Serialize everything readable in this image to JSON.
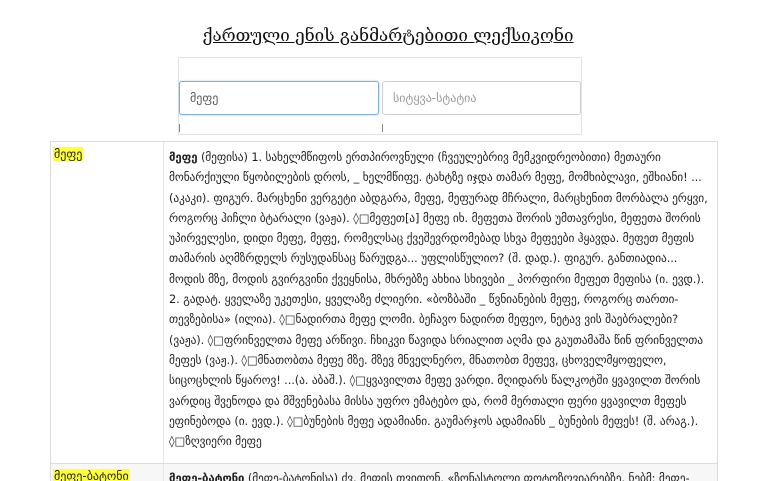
{
  "page_title": "ქართული ენის განმარტებითი ლექსიკონი",
  "search": {
    "word_value": "მეფე",
    "article_placeholder": "სიტყვა-სტატია"
  },
  "entries": [
    {
      "word": "მეფე",
      "headword": "მეფე",
      "definition": " (მეფისა) 1. სახელმწიფოს ერთპიროვნული (ჩვეულებრივ მემკვიდრეობითი) მეთაური მონარქიული წყობილების დროს, _ ხელმწიფე. ტახტზე იჯდა თამარ მეფე, მომხიბლავი, ეშხიანი! ...(აკაკი). ფიგურ. მარცხენი ვერგეტი აბდგარა, მეფე, მეფურად მჩრალი, მარცხენით მორბალა ერყვი, როგორც ჰიჩლი ბტარალი (ვაჟა). ◊□მეფეთ[ა] მეფე იხ. მეფეთა შორის უმთავრესი, მეფეთა შორის უპირველესი, დიდი მეფე, მეფე, რომელსაც ქვეშევრდომებად სხვა მეფეები ჰყავდა. მეფეთ მეფის თამარის აღმზრდელს რუსუდანსაც წარუდგა... უფლისწულიო? (შ. დად.). ფიგურ. განთიადია... მოდის მზე, მოდის გვირგვინი ქვეყნისა, მხრებზე ახხია სხივები _ პორფირი მეფეთ მეფისა (ი. ევდ.). 2. გადატ. ყველაზე უკეთესი, ყველაზე ძლიერი. «ბოზბაში _ წვნიანების მეფე, როგორც თართი-თევზებისა» (ილია). ◊□ნადირთა მეფე ლომი. ბეჩავო ნადირთ მეფეო, ნეტავ ვის შაებრალები? (ვაჟა). ◊□ფრინველთა მეფე არწივი. ჩხიკვი წავიდა სრიალით აღმა და გაუთამაშა წინ ფრინველთა მეფეს (ვაჟ.). ◊□მნათობთა მეფე მზე. მზევ მნველნერო, მნათობთ მეფევ, ცხოველმყოფელო, სიცოცხლის წყაროვ! ...(ა. აბაშ.). ◊□ყვავილთა მეფე ვარდი. მღიდარს წალკოტში ყვავილთ შორის ვარდიც შვენოდა და მშვენებასა მისსა უფრო ემატებო და, რომ მერთალი ფერი ყვავილთ მეფეს ეფინებოდა (ი. ევდ.). ◊□ბუნების მეფე ადამიანი. გაუმარჯოს ადამიანს _ ბუნების მეფეს! (შ. არაგ.). ◊□ზღვიერი მეფე"
    },
    {
      "word": "მეფე-ბატონი",
      "headword": "მეფე-ბატონი",
      "definition": " (მეფე-ბატონისა) ძვ. მეფის თვითონ. «ზონასტოლი ფოტოზღვიარებზე. ნებმ: მეფე-"
    }
  ]
}
